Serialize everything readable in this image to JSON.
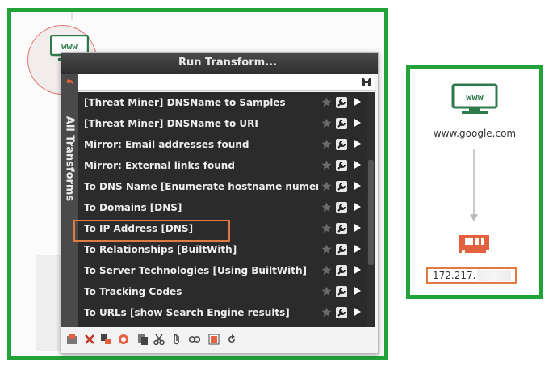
{
  "dialog": {
    "title": "Run Transform...",
    "side_tab": "All Transforms",
    "search_value": "",
    "items": [
      {
        "label": "[Threat Miner] DNSName to Samples"
      },
      {
        "label": "[Threat Miner] DNSName to URI"
      },
      {
        "label": "Mirror: Email addresses found"
      },
      {
        "label": "Mirror: External links found"
      },
      {
        "label": "To DNS Name [Enumerate hostname numeri..."
      },
      {
        "label": "To Domains [DNS]"
      },
      {
        "label": "To IP Address [DNS]"
      },
      {
        "label": "To Relationships [BuiltWith]"
      },
      {
        "label": "To Server Technologies [Using BuiltWith]"
      },
      {
        "label": "To Tracking Codes"
      },
      {
        "label": "To URLs [show Search Engine results]"
      }
    ],
    "highlighted_item": "To IP Address [DNS]"
  },
  "graph": {
    "left_node_icon_text": "www",
    "domain_node_icon_text": "www",
    "domain_label": "www.google.com",
    "ip_label": "172.217."
  },
  "colors": {
    "frame_green": "#22a33a",
    "highlight_orange": "#e07a43",
    "dialog_dark": "#2b2b2b"
  }
}
